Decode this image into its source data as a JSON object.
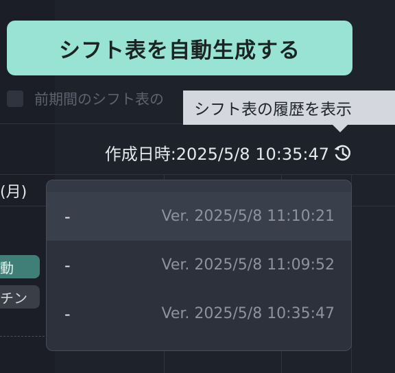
{
  "generate_button": {
    "label": "シフト表を自動生成する"
  },
  "option": {
    "label": "前期間のシフト表の"
  },
  "tooltip": {
    "text": "シフト表の履歴を表示"
  },
  "created": {
    "text": "作成日時:2025/5/8 10:35:47"
  },
  "calendar": {
    "day_label": "(月)",
    "chips": [
      {
        "text": "動"
      },
      {
        "text": "チン"
      }
    ]
  },
  "history": {
    "items": [
      {
        "name": "-",
        "version": "Ver. 2025/5/8 11:10:21"
      },
      {
        "name": "-",
        "version": "Ver. 2025/5/8 11:09:52"
      },
      {
        "name": "-",
        "version": "Ver. 2025/5/8 10:35:47"
      }
    ]
  },
  "colors": {
    "accent": "#98e3d3",
    "background": "#1e222b"
  }
}
